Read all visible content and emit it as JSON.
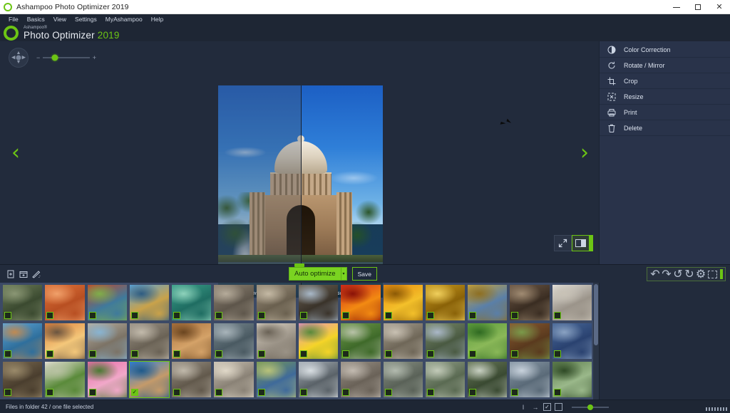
{
  "window": {
    "title": "Ashampoo Photo Optimizer 2019",
    "minimize_label": "Minimize",
    "restore_label": "Restore",
    "close_label": "✕"
  },
  "menubar": {
    "items": [
      {
        "label": "File"
      },
      {
        "label": "Basics"
      },
      {
        "label": "View"
      },
      {
        "label": "Settings"
      },
      {
        "label": "MyAshampoo"
      },
      {
        "label": "Help"
      }
    ]
  },
  "brand": {
    "superscript": "Ashampoo®",
    "name": "Photo Optimizer ",
    "year": "2019",
    "logo_icon": "ashampoo-ring-logo"
  },
  "preview": {
    "pan_control_icon": "pan-directional-pad",
    "zoom_minus": "−",
    "zoom_plus": "+",
    "prev_arrow": "‹",
    "next_arrow": "›",
    "label_original": "Original",
    "label_optimized": "Optimized",
    "fit_button_icon": "fullscreen-arrows-icon",
    "compare_button_icon": "split-compare-icon"
  },
  "sidebar": {
    "items": [
      {
        "label": "Color Correction",
        "icon": "contrast-circle-icon"
      },
      {
        "label": "Rotate / Mirror",
        "icon": "rotate-arrow-icon"
      },
      {
        "label": "Crop",
        "icon": "crop-frame-icon"
      },
      {
        "label": "Resize",
        "icon": "resize-corners-icon"
      },
      {
        "label": "Print",
        "icon": "printer-icon"
      },
      {
        "label": "Delete",
        "icon": "trash-bin-icon"
      }
    ]
  },
  "toolbar": {
    "left_icons": [
      {
        "name": "new-file-icon",
        "glyph": "＋"
      },
      {
        "name": "add-folder-icon",
        "glyph": "＋"
      },
      {
        "name": "magic-wand-icon",
        "glyph": "◢"
      }
    ],
    "auto_optimize_label": "Auto optimize",
    "auto_optimize_caret": "▾",
    "save_label": "Save",
    "right_icons": [
      {
        "name": "undo-icon",
        "glyph": "↶"
      },
      {
        "name": "redo-icon",
        "glyph": "↷"
      },
      {
        "name": "rotate-left-icon",
        "glyph": "↺"
      },
      {
        "name": "rotate-right-icon",
        "glyph": "↻"
      },
      {
        "name": "settings-gear-icon",
        "glyph": "⚙"
      }
    ]
  },
  "thumbnails": {
    "selected_index": 31,
    "items": [
      {
        "id": 1,
        "alt": "temple ruins in jungle",
        "colors": [
          "#6f7f5a",
          "#3b4a30",
          "#8a9674"
        ]
      },
      {
        "id": 2,
        "alt": "orange sandstone canyon",
        "colors": [
          "#e0743a",
          "#b84f22",
          "#f0a06a"
        ]
      },
      {
        "id": 3,
        "alt": "red tropical plant by sea",
        "colors": [
          "#c3452a",
          "#3f7a9c",
          "#7fae4a"
        ]
      },
      {
        "id": 4,
        "alt": "golden spire over water",
        "colors": [
          "#5ba3d8",
          "#c9a24a",
          "#2e5c82"
        ]
      },
      {
        "id": 5,
        "alt": "green peacock feathers",
        "colors": [
          "#3ba08a",
          "#1f6d62",
          "#8ed2bb"
        ]
      },
      {
        "id": 6,
        "alt": "stone carved face",
        "colors": [
          "#8e8374",
          "#5e564b",
          "#b5ab9a"
        ]
      },
      {
        "id": 7,
        "alt": "stone arch ruins",
        "colors": [
          "#9a8e7b",
          "#6a604f",
          "#c4b9a4"
        ]
      },
      {
        "id": 8,
        "alt": "dark wooden church",
        "colors": [
          "#6d6354",
          "#3a332a",
          "#a8b8c8"
        ]
      },
      {
        "id": 9,
        "alt": "red and orange flowers",
        "colors": [
          "#d22c1b",
          "#f28a12",
          "#8a1208"
        ]
      },
      {
        "id": 10,
        "alt": "orange tulip bouquet",
        "colors": [
          "#e8890f",
          "#f3c02a",
          "#8c5a06"
        ]
      },
      {
        "id": 11,
        "alt": "golden buddha statue",
        "colors": [
          "#c99a1e",
          "#8a6208",
          "#f0cf5c"
        ]
      },
      {
        "id": 12,
        "alt": "ornate temple roof",
        "colors": [
          "#c6a33d",
          "#5a7fa8",
          "#8e6f22"
        ]
      },
      {
        "id": 13,
        "alt": "person at doorway",
        "colors": [
          "#6f5a48",
          "#3a2d22",
          "#a08b72"
        ]
      },
      {
        "id": 14,
        "alt": "man in white robe",
        "colors": [
          "#e5e2dc",
          "#9b948a",
          "#c8c2b6"
        ]
      },
      {
        "id": 15,
        "alt": "boat on turquoise bay",
        "colors": [
          "#5fa6d8",
          "#2f6f9c",
          "#c08a52"
        ]
      },
      {
        "id": 16,
        "alt": "sunset over beach",
        "colors": [
          "#e07f3a",
          "#f3c77a",
          "#6a5540"
        ]
      },
      {
        "id": 17,
        "alt": "beach huts",
        "colors": [
          "#b8b0a2",
          "#7c7366",
          "#88b4d2"
        ]
      },
      {
        "id": 18,
        "alt": "rock formation",
        "colors": [
          "#9c9488",
          "#6a6255",
          "#c2baab"
        ]
      },
      {
        "id": 19,
        "alt": "camel in desert",
        "colors": [
          "#a86f3a",
          "#d4a268",
          "#6a4520"
        ]
      },
      {
        "id": 20,
        "alt": "old rusted truck",
        "colors": [
          "#7a8a92",
          "#4a5a62",
          "#a8b4ba"
        ]
      },
      {
        "id": 21,
        "alt": "white dog portrait",
        "colors": [
          "#d8d0c2",
          "#9a9286",
          "#6a6256"
        ]
      },
      {
        "id": 22,
        "alt": "pink anemone flower",
        "colors": [
          "#e892c0",
          "#f4d428",
          "#5a8a3a"
        ]
      },
      {
        "id": 23,
        "alt": "garden colonnade",
        "colors": [
          "#6f9a4a",
          "#3f6a2a",
          "#b8c2a8"
        ]
      },
      {
        "id": 24,
        "alt": "limestone pinnacles",
        "colors": [
          "#a8a092",
          "#6f6758",
          "#c8c0b2"
        ]
      },
      {
        "id": 25,
        "alt": "mountain valley cliff",
        "colors": [
          "#7a8a6a",
          "#4a5a42",
          "#aab8c8"
        ]
      },
      {
        "id": 26,
        "alt": "green meadow flowers",
        "colors": [
          "#5a9a3a",
          "#8ab858",
          "#2f6a22"
        ]
      },
      {
        "id": 27,
        "alt": "clay pots in field",
        "colors": [
          "#8a5a32",
          "#5a3a1e",
          "#7a9a4a"
        ]
      },
      {
        "id": 28,
        "alt": "blue speckled pattern",
        "colors": [
          "#4a6a9a",
          "#2a4270",
          "#8aa2c2"
        ]
      },
      {
        "id": 29,
        "alt": "wooden cabin",
        "colors": [
          "#7a6a52",
          "#4a3e2e",
          "#9a8a6a"
        ]
      },
      {
        "id": 30,
        "alt": "white roses",
        "colors": [
          "#e8e2d8",
          "#5a8a3a",
          "#b8c2a2"
        ]
      },
      {
        "id": 31,
        "alt": "pink peonies",
        "colors": [
          "#e86aa8",
          "#f0a8c8",
          "#4a7a32"
        ]
      },
      {
        "id": 32,
        "alt": "palace of fine arts rotunda",
        "colors": [
          "#2f7fd8",
          "#c49a6a",
          "#1f5a8a"
        ]
      },
      {
        "id": 33,
        "alt": "ancient stone temple",
        "colors": [
          "#9a9286",
          "#62594c",
          "#c0b8aa"
        ]
      },
      {
        "id": 34,
        "alt": "rocky white cliffs",
        "colors": [
          "#cac2b4",
          "#8a8276",
          "#e0d8c8"
        ]
      },
      {
        "id": 35,
        "alt": "green field and lake",
        "colors": [
          "#7a9a52",
          "#3f6a9a",
          "#b8c27a"
        ]
      },
      {
        "id": 36,
        "alt": "waterfall over rocks",
        "colors": [
          "#aab2ba",
          "#5a6268",
          "#d8dee2"
        ]
      },
      {
        "id": 37,
        "alt": "stone wall texture",
        "colors": [
          "#9a9288",
          "#6a6258",
          "#c2bab0"
        ]
      },
      {
        "id": 38,
        "alt": "boulder river bed",
        "colors": [
          "#8a9286",
          "#5a6258",
          "#b2baae"
        ]
      },
      {
        "id": 39,
        "alt": "mountain stream rocks",
        "colors": [
          "#92a08a",
          "#5a6a52",
          "#c2cab8"
        ]
      },
      {
        "id": 40,
        "alt": "tall waterfall in forest",
        "colors": [
          "#6a7a5a",
          "#3a4a32",
          "#c8d0c2"
        ]
      },
      {
        "id": 41,
        "alt": "glacier valley",
        "colors": [
          "#8a9aa8",
          "#5a6a78",
          "#c8d2dc"
        ]
      },
      {
        "id": 42,
        "alt": "forest path walker",
        "colors": [
          "#5a7a4a",
          "#9ab88a",
          "#2f4a26"
        ]
      }
    ]
  },
  "statusbar": {
    "text": "Files in folder 42 / one file selected",
    "icons": [
      {
        "name": "cursor-text-icon",
        "glyph": "I"
      },
      {
        "name": "arrow-right-icon",
        "glyph": "→"
      },
      {
        "name": "checkbox-checked-icon",
        "glyph": "✓"
      },
      {
        "name": "checkbox-empty-icon",
        "glyph": ""
      }
    ],
    "thumb_size_value": "50"
  },
  "colors": {
    "accent_green": "#6cc514",
    "panel_bg": "#29334a",
    "app_bg": "#222b3c",
    "thumb_bg": "#3c4a66"
  }
}
